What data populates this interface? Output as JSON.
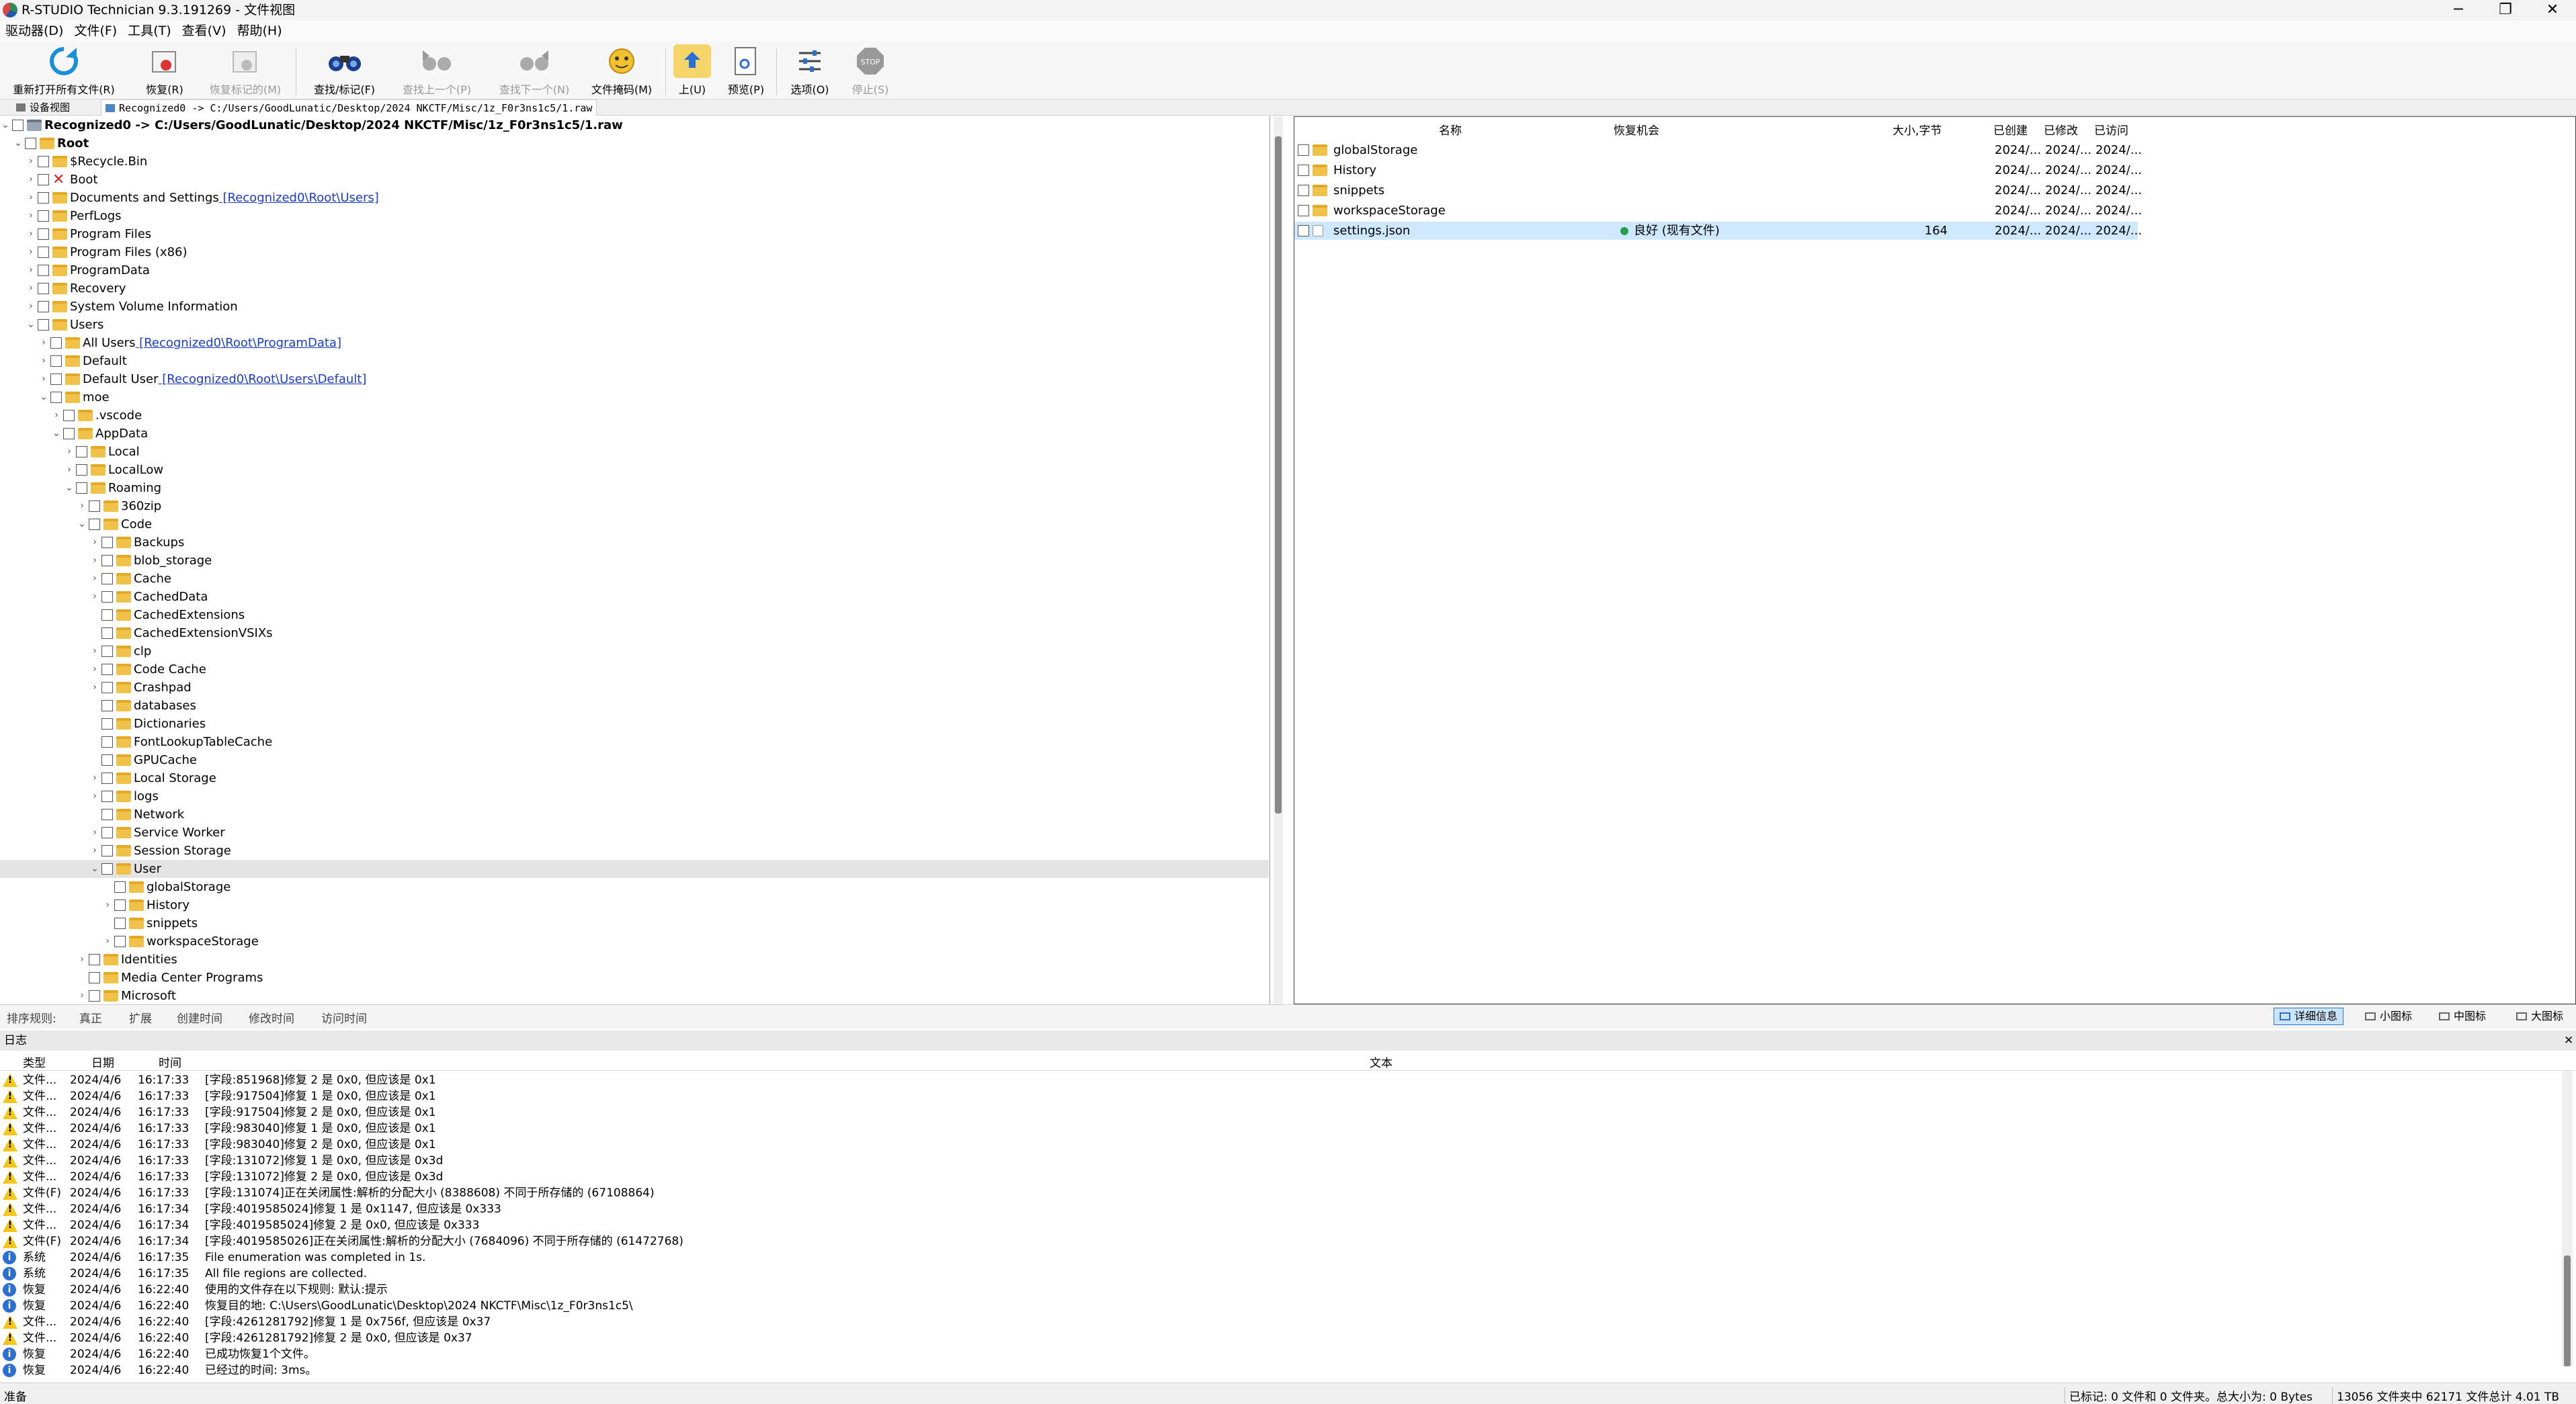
{
  "window": {
    "title": "R-STUDIO Technician 9.3.191269 - 文件视图",
    "minimize": "─",
    "restore": "❐",
    "close": "✕"
  },
  "menu": [
    "驱动器(D)",
    "文件(F)",
    "工具(T)",
    "查看(V)",
    "帮助(H)"
  ],
  "toolbar": [
    {
      "label": "重新打开所有文件(R)",
      "icon": "refresh-icon",
      "enabled": true
    },
    {
      "label": "恢复(R)",
      "icon": "recover-icon",
      "enabled": true
    },
    {
      "label": "恢复标记的(M)",
      "icon": "recover-marked-icon",
      "enabled": false
    },
    {
      "label": "查找/标记(F)",
      "icon": "binoculars-icon",
      "enabled": true
    },
    {
      "label": "查找上一个(P)",
      "icon": "find-prev-icon",
      "enabled": false
    },
    {
      "label": "查找下一个(N)",
      "icon": "find-next-icon",
      "enabled": false
    },
    {
      "label": "文件掩码(M)",
      "icon": "file-mask-icon",
      "enabled": true
    },
    {
      "label": "上(U)",
      "icon": "up-folder-icon",
      "enabled": true
    },
    {
      "label": "预览(P)",
      "icon": "preview-icon",
      "enabled": true
    },
    {
      "label": "选项(O)",
      "icon": "options-icon",
      "enabled": true
    },
    {
      "label": "停止(S)",
      "icon": "stop-icon",
      "enabled": false
    }
  ],
  "tabs": [
    {
      "label": "设备视图"
    },
    {
      "label": "Recognized0 -> C:/Users/GoodLunatic/Desktop/2024 NKCTF/Misc/1z_F0r3ns1c5/1.raw"
    }
  ],
  "tree": [
    {
      "level": 0,
      "expand": "v",
      "label": "Recognized0 -> C:/Users/GoodLunatic/Desktop/2024 NKCTF/Misc/1z_F0r3ns1c5/1.raw",
      "bold": true,
      "icon": "drive"
    },
    {
      "level": 1,
      "expand": "v",
      "label": "Root",
      "bold": true
    },
    {
      "level": 2,
      "expand": ">",
      "label": "$Recycle.Bin"
    },
    {
      "level": 2,
      "expand": ">",
      "label": "Boot",
      "icon": "deleted"
    },
    {
      "level": 2,
      "expand": ">",
      "label": "Documents and Settings",
      "link": "[Recognized0\\Root\\Users]"
    },
    {
      "level": 2,
      "expand": ">",
      "label": "PerfLogs"
    },
    {
      "level": 2,
      "expand": ">",
      "label": "Program Files"
    },
    {
      "level": 2,
      "expand": ">",
      "label": "Program Files (x86)"
    },
    {
      "level": 2,
      "expand": ">",
      "label": "ProgramData"
    },
    {
      "level": 2,
      "expand": ">",
      "label": "Recovery"
    },
    {
      "level": 2,
      "expand": ">",
      "label": "System Volume Information"
    },
    {
      "level": 2,
      "expand": "v",
      "label": "Users"
    },
    {
      "level": 3,
      "expand": ">",
      "label": "All Users",
      "link": "[Recognized0\\Root\\ProgramData]"
    },
    {
      "level": 3,
      "expand": ">",
      "label": "Default"
    },
    {
      "level": 3,
      "expand": ">",
      "label": "Default User",
      "link": "[Recognized0\\Root\\Users\\Default]"
    },
    {
      "level": 3,
      "expand": "v",
      "label": "moe"
    },
    {
      "level": 4,
      "expand": ">",
      "label": ".vscode"
    },
    {
      "level": 4,
      "expand": "v",
      "label": "AppData"
    },
    {
      "level": 5,
      "expand": ">",
      "label": "Local"
    },
    {
      "level": 5,
      "expand": ">",
      "label": "LocalLow"
    },
    {
      "level": 5,
      "expand": "v",
      "label": "Roaming"
    },
    {
      "level": 6,
      "expand": ">",
      "label": "360zip"
    },
    {
      "level": 6,
      "expand": "v",
      "label": "Code"
    },
    {
      "level": 7,
      "expand": ">",
      "label": "Backups"
    },
    {
      "level": 7,
      "expand": ">",
      "label": "blob_storage"
    },
    {
      "level": 7,
      "expand": ">",
      "label": "Cache"
    },
    {
      "level": 7,
      "expand": ">",
      "label": "CachedData"
    },
    {
      "level": 7,
      "expand": "",
      "label": "CachedExtensions"
    },
    {
      "level": 7,
      "expand": "",
      "label": "CachedExtensionVSIXs"
    },
    {
      "level": 7,
      "expand": ">",
      "label": "clp"
    },
    {
      "level": 7,
      "expand": ">",
      "label": "Code Cache"
    },
    {
      "level": 7,
      "expand": ">",
      "label": "Crashpad"
    },
    {
      "level": 7,
      "expand": "",
      "label": "databases"
    },
    {
      "level": 7,
      "expand": "",
      "label": "Dictionaries"
    },
    {
      "level": 7,
      "expand": "",
      "label": "FontLookupTableCache"
    },
    {
      "level": 7,
      "expand": "",
      "label": "GPUCache"
    },
    {
      "level": 7,
      "expand": ">",
      "label": "Local Storage"
    },
    {
      "level": 7,
      "expand": ">",
      "label": "logs"
    },
    {
      "level": 7,
      "expand": "",
      "label": "Network"
    },
    {
      "level": 7,
      "expand": ">",
      "label": "Service Worker"
    },
    {
      "level": 7,
      "expand": ">",
      "label": "Session Storage"
    },
    {
      "level": 7,
      "expand": "v",
      "label": "User",
      "selected": true
    },
    {
      "level": 8,
      "expand": "",
      "label": "globalStorage"
    },
    {
      "level": 8,
      "expand": ">",
      "label": "History"
    },
    {
      "level": 8,
      "expand": "",
      "label": "snippets"
    },
    {
      "level": 8,
      "expand": ">",
      "label": "workspaceStorage"
    },
    {
      "level": 6,
      "expand": ">",
      "label": "Identities"
    },
    {
      "level": 6,
      "expand": "",
      "label": "Media Center Programs"
    },
    {
      "level": 6,
      "expand": ">",
      "label": "Microsoft"
    }
  ],
  "files": {
    "headers": {
      "name": "名称",
      "chance": "恢复机会",
      "size": "大小,字节",
      "created": "已创建",
      "modified": "已修改",
      "accessed": "已访问"
    },
    "rows": [
      {
        "name": "globalStorage",
        "type": "folder",
        "chance": "",
        "size": "",
        "created": "2024/...",
        "modified": "2024/...",
        "accessed": "2024/..."
      },
      {
        "name": "History",
        "type": "folder",
        "chance": "",
        "size": "",
        "created": "2024/...",
        "modified": "2024/...",
        "accessed": "2024/..."
      },
      {
        "name": "snippets",
        "type": "folder",
        "chance": "",
        "size": "",
        "created": "2024/...",
        "modified": "2024/...",
        "accessed": "2024/..."
      },
      {
        "name": "workspaceStorage",
        "type": "folder",
        "chance": "",
        "size": "",
        "created": "2024/...",
        "modified": "2024/...",
        "accessed": "2024/..."
      },
      {
        "name": "settings.json",
        "type": "file",
        "chance": "良好 (现有文件)",
        "size": "164",
        "created": "2024/...",
        "modified": "2024/...",
        "accessed": "2024/...",
        "selected": true
      }
    ],
    "good_color": "#22a04b"
  },
  "sortbar": {
    "label": "排序规则:",
    "items": [
      "真正",
      "扩展",
      "创建时间",
      "修改时间",
      "访问时间"
    ],
    "views": [
      "详细信息",
      "小图标",
      "中图标",
      "大图标"
    ],
    "active_view": "详细信息"
  },
  "log": {
    "title": "日志",
    "close": "✕",
    "headers": {
      "type": "类型",
      "date": "日期",
      "time": "时间",
      "text": "文本"
    },
    "rows": [
      {
        "icon": "warning",
        "type": "文件...",
        "date": "2024/4/6",
        "time": "16:17:33",
        "text": "[字段:851968]修复 2 是 0x0, 但应该是 0x1"
      },
      {
        "icon": "warning",
        "type": "文件...",
        "date": "2024/4/6",
        "time": "16:17:33",
        "text": "[字段:917504]修复 1 是 0x0, 但应该是 0x1"
      },
      {
        "icon": "warning",
        "type": "文件...",
        "date": "2024/4/6",
        "time": "16:17:33",
        "text": "[字段:917504]修复 2 是 0x0, 但应该是 0x1"
      },
      {
        "icon": "warning",
        "type": "文件...",
        "date": "2024/4/6",
        "time": "16:17:33",
        "text": "[字段:983040]修复 1 是 0x0, 但应该是 0x1"
      },
      {
        "icon": "warning",
        "type": "文件...",
        "date": "2024/4/6",
        "time": "16:17:33",
        "text": "[字段:983040]修复 2 是 0x0, 但应该是 0x1"
      },
      {
        "icon": "warning",
        "type": "文件...",
        "date": "2024/4/6",
        "time": "16:17:33",
        "text": "[字段:131072]修复 1 是 0x0, 但应该是 0x3d"
      },
      {
        "icon": "warning",
        "type": "文件...",
        "date": "2024/4/6",
        "time": "16:17:33",
        "text": "[字段:131072]修复 2 是 0x0, 但应该是 0x3d"
      },
      {
        "icon": "warning",
        "type": "文件(F)",
        "date": "2024/4/6",
        "time": "16:17:33",
        "text": "[字段:131074]正在关闭属性:解析的分配大小 (8388608) 不同于所存储的 (67108864)"
      },
      {
        "icon": "warning",
        "type": "文件...",
        "date": "2024/4/6",
        "time": "16:17:34",
        "text": "[字段:4019585024]修复 1 是 0x1147, 但应该是 0x333"
      },
      {
        "icon": "warning",
        "type": "文件...",
        "date": "2024/4/6",
        "time": "16:17:34",
        "text": "[字段:4019585024]修复 2 是 0x0, 但应该是 0x333"
      },
      {
        "icon": "warning",
        "type": "文件(F)",
        "date": "2024/4/6",
        "time": "16:17:34",
        "text": "[字段:4019585026]正在关闭属性:解析的分配大小 (7684096) 不同于所存储的 (61472768)"
      },
      {
        "icon": "info",
        "type": "系统",
        "date": "2024/4/6",
        "time": "16:17:35",
        "text": "File enumeration was completed in 1s."
      },
      {
        "icon": "info",
        "type": "系统",
        "date": "2024/4/6",
        "time": "16:17:35",
        "text": "All file regions are collected."
      },
      {
        "icon": "info",
        "type": "恢复",
        "date": "2024/4/6",
        "time": "16:22:40",
        "text": "使用的文件存在以下规则: 默认:提示"
      },
      {
        "icon": "info",
        "type": "恢复",
        "date": "2024/4/6",
        "time": "16:22:40",
        "text": "恢复目的地: C:\\Users\\GoodLunatic\\Desktop\\2024 NKCTF\\Misc\\1z_F0r3ns1c5\\"
      },
      {
        "icon": "warning",
        "type": "文件...",
        "date": "2024/4/6",
        "time": "16:22:40",
        "text": "[字段:4261281792]修复 1 是 0x756f, 但应该是 0x37"
      },
      {
        "icon": "warning",
        "type": "文件...",
        "date": "2024/4/6",
        "time": "16:22:40",
        "text": "[字段:4261281792]修复 2 是 0x0, 但应该是 0x37"
      },
      {
        "icon": "info",
        "type": "恢复",
        "date": "2024/4/6",
        "time": "16:22:40",
        "text": "已成功恢复1个文件。"
      },
      {
        "icon": "info",
        "type": "恢复",
        "date": "2024/4/6",
        "time": "16:22:40",
        "text": "已经过的时间: 3ms。"
      }
    ]
  },
  "status": {
    "left": "准备",
    "marked": "已标记: 0 文件和 0 文件夹。总大小为: 0 Bytes",
    "total": "13056 文件夹中 62171 文件总计 4.01 TB"
  }
}
